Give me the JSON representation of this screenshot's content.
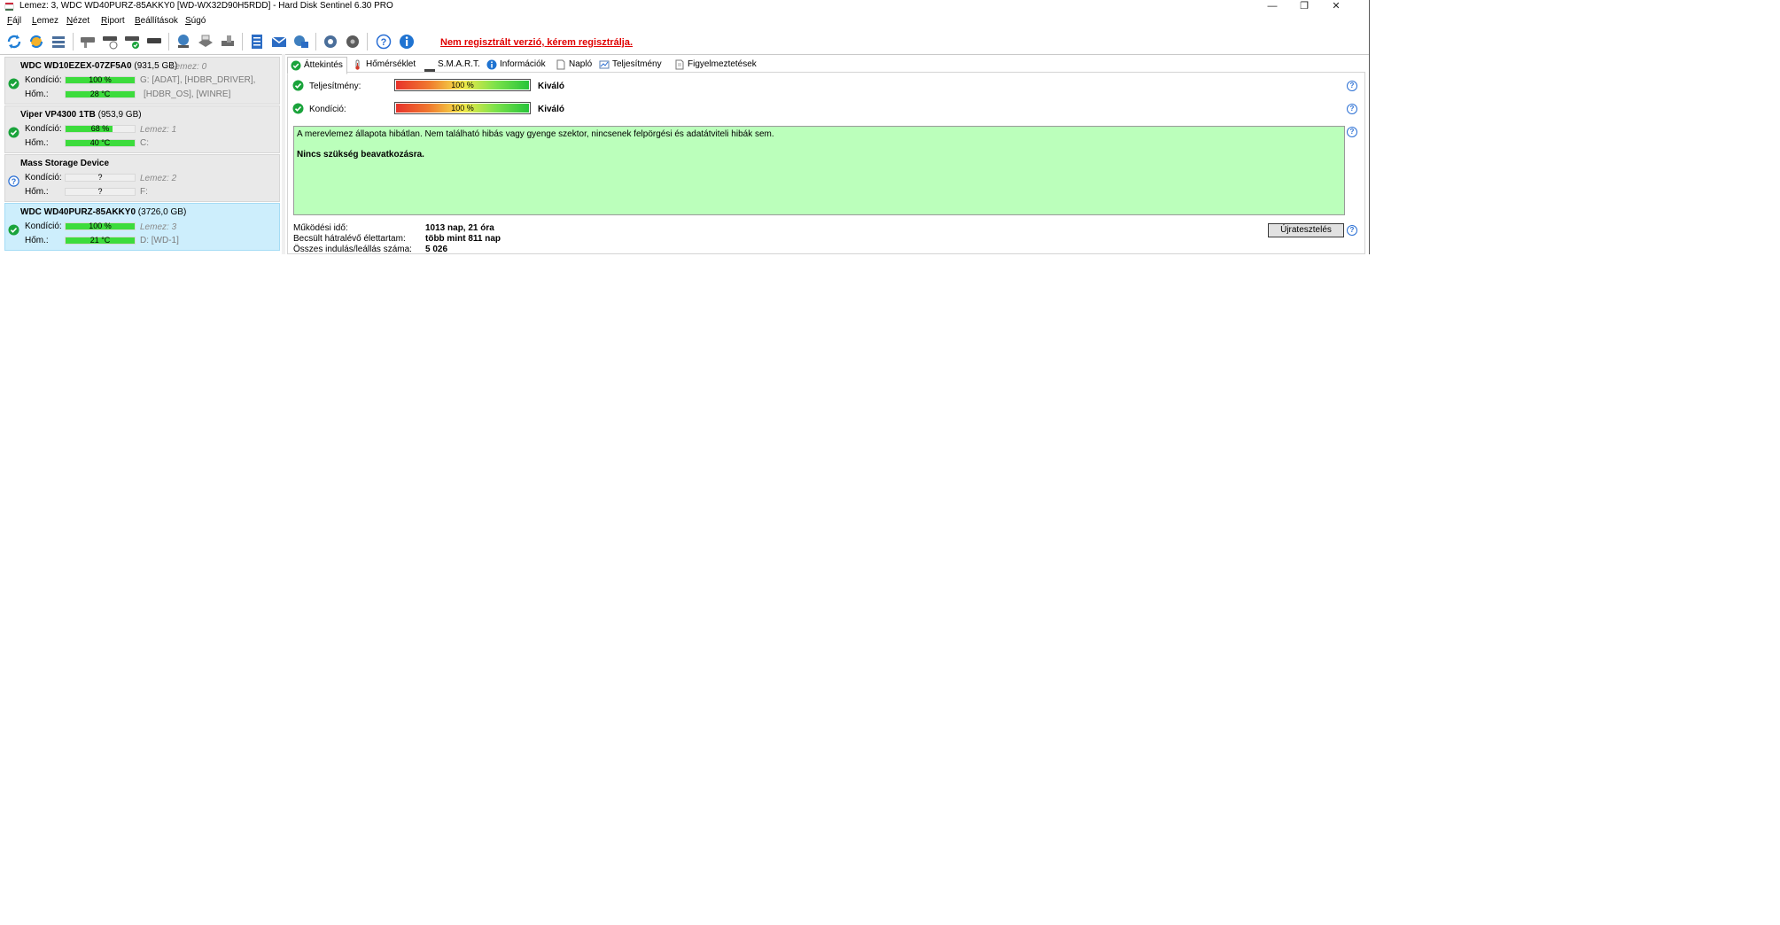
{
  "window": {
    "title": "Lemez: 3, WDC WD40PURZ-85AKKY0 [WD-WX32D90H5RDD]  -  Hard Disk Sentinel 6.30 PRO",
    "buttons": {
      "minimize": "—",
      "maximize": "❐",
      "close": "✕"
    }
  },
  "menu": [
    "Fájl",
    "Lemez",
    "Nézet",
    "Riport",
    "Beállítások",
    "Súgó"
  ],
  "toolbar": {
    "icons": [
      "refresh-icon",
      "refresh-all-icon",
      "disk-list-icon",
      "hdd-icon",
      "hdd-time-icon",
      "hdd-check-icon",
      "hdd-icon",
      "network-icon",
      "printer-icon",
      "hdd-settings-icon",
      "report-icon",
      "mail-icon",
      "send-report-icon",
      "gear-icon",
      "disk-settings-icon",
      "help-icon",
      "info-icon"
    ],
    "registration_link": "Nem regisztrált verzió, kérem regisztrálja."
  },
  "disks": [
    {
      "name": "WDC WD10EZEX-07ZF5A0",
      "size": "(931,5 GB)",
      "index": "Lemez: 0",
      "status": "ok",
      "condition_label": "Kondíció:",
      "condition": "100 %",
      "condition_fraction": 1.0,
      "temp_label": "Hőm.:",
      "temp": "28 °C",
      "temp_fraction": 1.0,
      "drives_line1": "G: [ADAT],  [HDBR_DRIVER],",
      "drives_line2": "[HDBR_OS],  [WINRE]",
      "selected": false
    },
    {
      "name": "Viper VP4300 1TB",
      "size": "(953,9 GB)",
      "index": "Lemez: 1",
      "status": "ok",
      "condition_label": "Kondíció:",
      "condition": "68 %",
      "condition_fraction": 0.68,
      "temp_label": "Hőm.:",
      "temp": "40 °C",
      "temp_fraction": 1.0,
      "drives_line1": "C:",
      "selected": false
    },
    {
      "name": "Mass   Storage Device",
      "size": "",
      "index": "Lemez: 2",
      "status": "unknown",
      "condition_label": "Kondíció:",
      "condition": "?",
      "condition_fraction": 0,
      "temp_label": "Hőm.:",
      "temp": "?",
      "temp_fraction": 0,
      "drives_line1": "F:",
      "selected": false
    },
    {
      "name": "WDC WD40PURZ-85AKKY0",
      "size": "(3726,0 GB)",
      "index": "Lemez: 3",
      "status": "ok",
      "condition_label": "Kondíció:",
      "condition": "100 %",
      "condition_fraction": 1.0,
      "temp_label": "Hőm.:",
      "temp": "21 °C",
      "temp_fraction": 1.0,
      "drives_line1": "D: [WD-1]",
      "selected": true
    }
  ],
  "tabs": [
    {
      "label": "Áttekintés",
      "icon": "check-icon",
      "active": true
    },
    {
      "label": "Hőmérséklet",
      "icon": "thermometer-icon",
      "active": false
    },
    {
      "label": "S.M.A.R.T.",
      "icon": "smart-icon",
      "active": false
    },
    {
      "label": "Információk",
      "icon": "info-icon",
      "active": false
    },
    {
      "label": "Napló",
      "icon": "document-icon",
      "active": false
    },
    {
      "label": "Teljesítmény",
      "icon": "chart-icon",
      "active": false
    },
    {
      "label": "Figyelmeztetések",
      "icon": "alert-document-icon",
      "active": false
    }
  ],
  "overview": {
    "performance": {
      "label": "Teljesítmény:",
      "value": "100 %",
      "fraction": 1.0,
      "rating": "Kiváló"
    },
    "health": {
      "label": "Kondíció:",
      "value": "100 %",
      "fraction": 1.0,
      "rating": "Kiváló"
    },
    "status_message": "A merevlemez állapota hibátlan. Nem található hibás vagy gyenge szektor, nincsenek felpörgési és adatátviteli hibák sem.",
    "action_message": "Nincs szükség beavatkozásra.",
    "power_on_label": "Működési idő:",
    "power_on_value": "1013 nap, 21 óra",
    "lifetime_label": "Becsült hátralévő élettartam:",
    "lifetime_value": "több mint 811 nap",
    "startstop_label": "Összes indulás/leállás száma:",
    "startstop_value": "5 026",
    "retest_button": "Újratesztelés"
  },
  "colors": {
    "ok_green": "#1aa33b",
    "bar_green": "#3cdc3c",
    "status_box": "#bbffbb",
    "selected_disk": "#cdeefc",
    "registration_red": "#e00000",
    "help_blue": "#2a6fd4"
  }
}
